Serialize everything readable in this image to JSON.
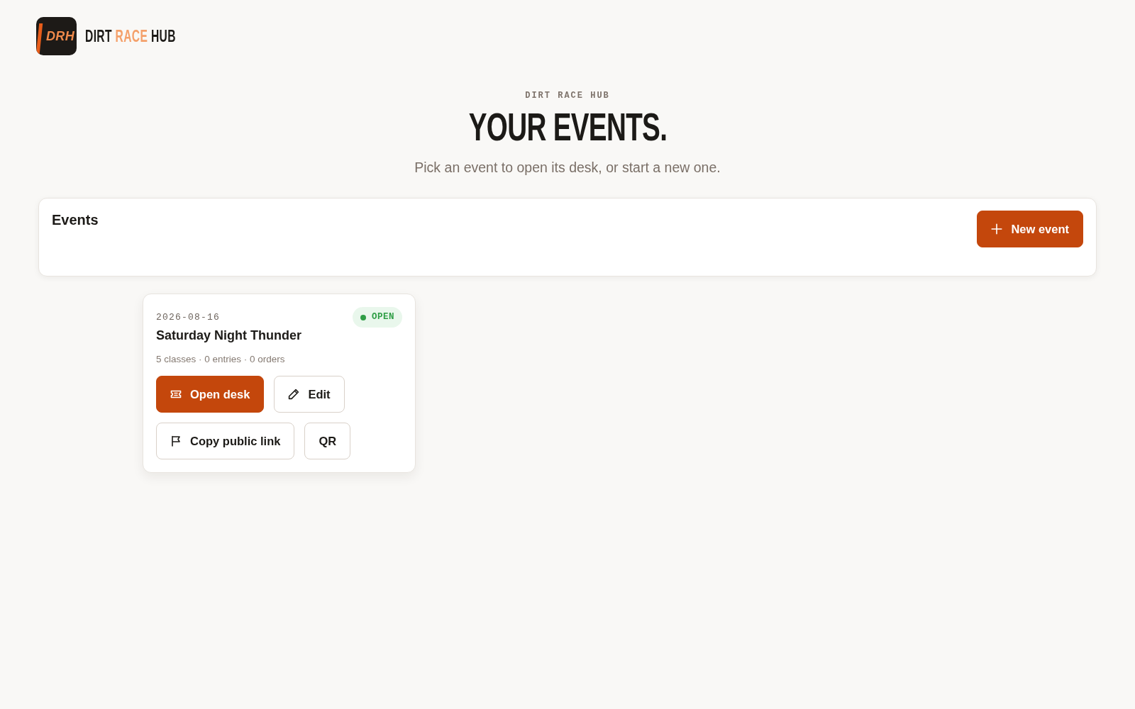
{
  "brand": {
    "logo_text": "DRH",
    "name_words": [
      {
        "text": "DIRT",
        "accent": false
      },
      {
        "text": "RACE",
        "accent": true
      },
      {
        "text": "HUB",
        "accent": false
      }
    ]
  },
  "hero": {
    "eyebrow": "DIRT RACE HUB",
    "title": "YOUR EVENTS.",
    "subtitle": "Pick an event to open its desk, or start a new one."
  },
  "events_panel": {
    "title": "Events",
    "new_button": {
      "label": "New event"
    }
  },
  "events": [
    {
      "date": "2026-08-16",
      "status": {
        "label": "OPEN",
        "kind": "open"
      },
      "name": "Saturday Night Thunder",
      "summary": "5 classes · 0 entries · 0 orders",
      "action_rows": [
        [
          {
            "label": "Open desk",
            "kind": "open-desk"
          },
          {
            "label": "Edit",
            "kind": "edit"
          }
        ],
        [
          {
            "label": "Copy public link",
            "kind": "copy-link"
          },
          {
            "label": "QR",
            "kind": "qr"
          }
        ]
      ]
    }
  ]
}
